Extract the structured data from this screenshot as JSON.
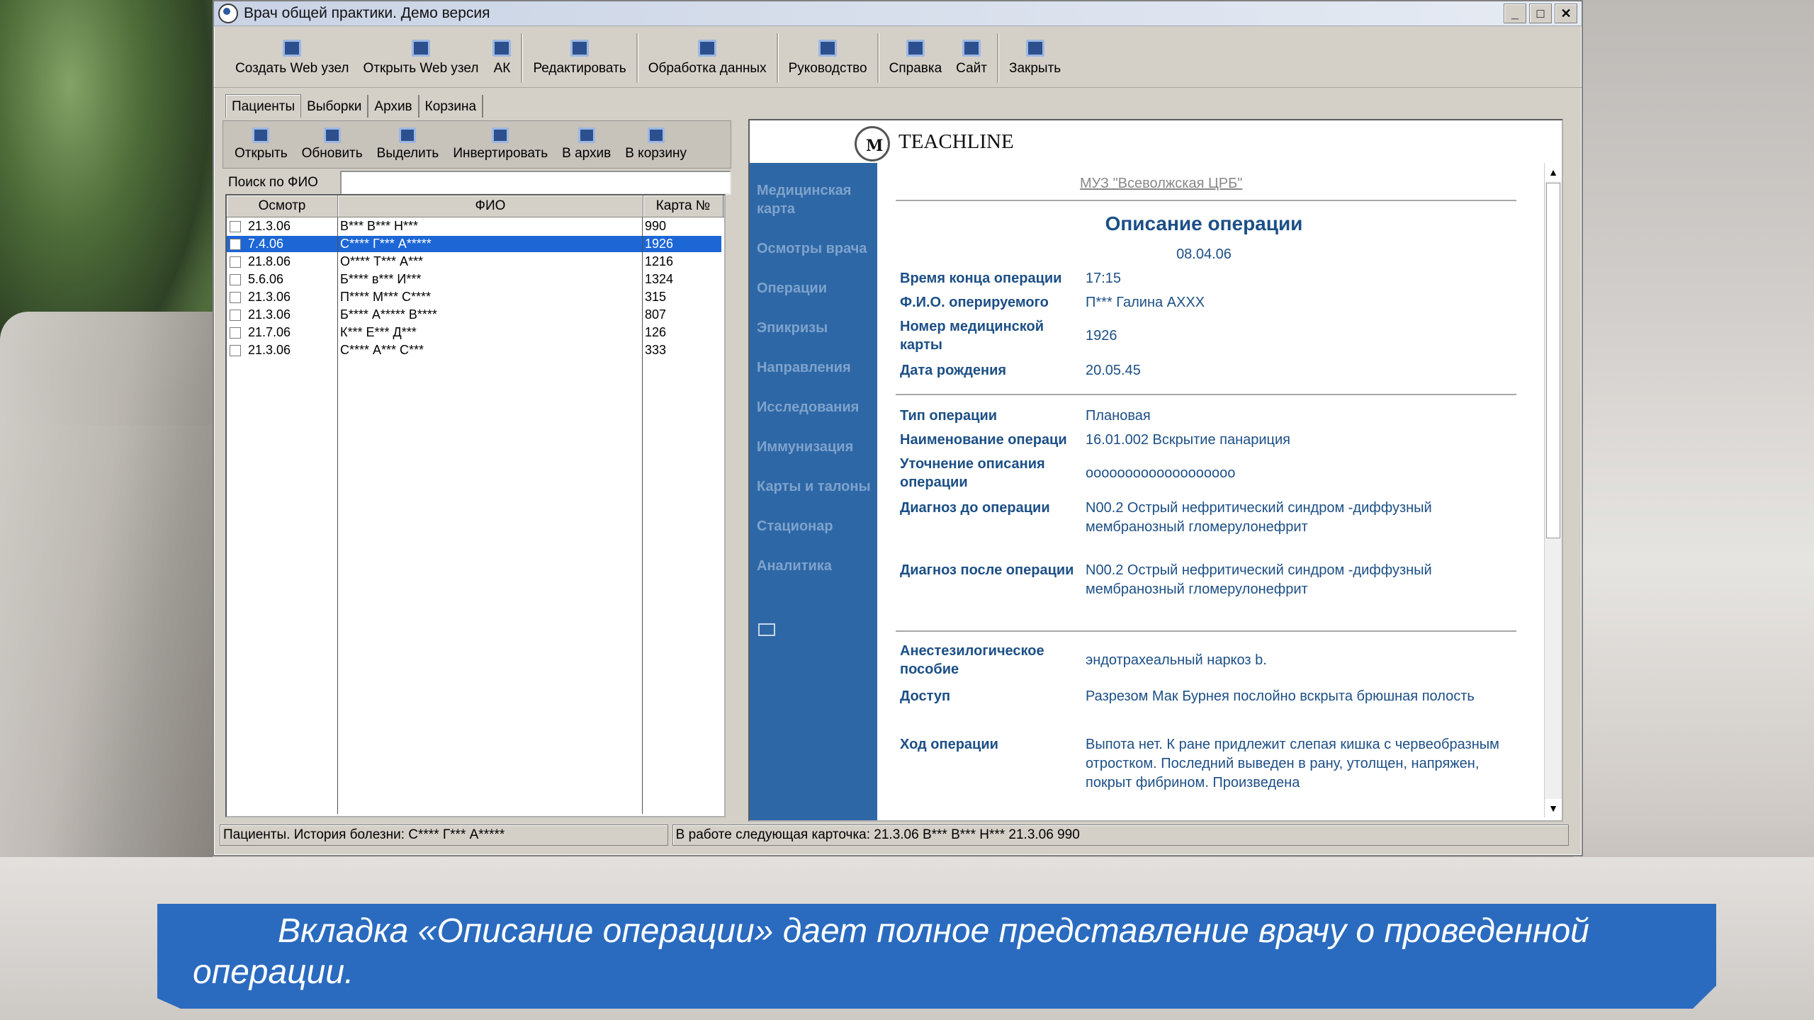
{
  "window": {
    "title": "Врач общей практики. Демо версия",
    "controls": [
      "_",
      "□",
      "✕"
    ]
  },
  "toolbar": [
    {
      "label": "Создать Web узел",
      "icon": "web-create-icon"
    },
    {
      "label": "Открыть Web узел",
      "icon": "web-open-icon"
    },
    {
      "label": "АК",
      "icon": "ak-icon"
    },
    {
      "label": "Редактировать",
      "icon": "edit-icon"
    },
    {
      "label": "Обработка данных",
      "icon": "data-processing-icon"
    },
    {
      "label": "Руководство",
      "icon": "manual-icon"
    },
    {
      "label": "Справка",
      "icon": "help-icon"
    },
    {
      "label": "Сайт",
      "icon": "site-icon"
    },
    {
      "label": "Закрыть",
      "icon": "close-x-icon"
    }
  ],
  "left_panel": {
    "tabs": [
      "Пациенты",
      "Выборки",
      "Архив",
      "Корзина"
    ],
    "actions": [
      {
        "label": "Открыть",
        "icon": "open-icon"
      },
      {
        "label": "Обновить",
        "icon": "refresh-icon"
      },
      {
        "label": "Выделить",
        "icon": "select-icon"
      },
      {
        "label": "Инвертировать",
        "icon": "invert-icon"
      },
      {
        "label": "В архив",
        "icon": "archive-icon"
      },
      {
        "label": "В корзину",
        "icon": "trash-icon"
      }
    ],
    "search_label": "Поиск по ФИО",
    "search_value": "",
    "columns": [
      "Осмотр",
      "ФИО",
      "Карта №"
    ],
    "rows": [
      {
        "date": "21.3.06",
        "name": "В*** В*** Н***",
        "card": "990"
      },
      {
        "date": "7.4.06",
        "name": "С**** Г*** А*****",
        "card": "1926"
      },
      {
        "date": "21.8.06",
        "name": "О**** Т*** А***",
        "card": "1216"
      },
      {
        "date": "5.6.06",
        "name": "Б**** в*** И***",
        "card": "1324"
      },
      {
        "date": "21.3.06",
        "name": "П**** М*** С****",
        "card": "315"
      },
      {
        "date": "21.3.06",
        "name": "Б**** А***** В****",
        "card": "807"
      },
      {
        "date": "21.7.06",
        "name": "К*** Е*** Д***",
        "card": "126"
      },
      {
        "date": "21.3.06",
        "name": "С**** А*** С***",
        "card": "333"
      }
    ]
  },
  "right_panel": {
    "brand": "TEACHLINE",
    "sidebar": [
      "Медицинская карта",
      "Осмотры врача",
      "Операции",
      "Эпикризы",
      "Направления",
      "Исследования",
      "Иммунизация",
      "Карты и талоны",
      "Стационар",
      "Аналитика"
    ],
    "org": "МУЗ \"Всеволжская ЦРБ\"",
    "title": "Описание операции",
    "date": "08.04.06",
    "fields": [
      {
        "label": "Время конца операции",
        "value": "17:15"
      },
      {
        "label": "Ф.И.О. оперируемого",
        "value": "П*** Галина АХХХ"
      },
      {
        "label": "Номер медицинской карты",
        "value": "1926"
      },
      {
        "label": "Дата рождения",
        "value": "20.05.45"
      },
      {
        "label": "Тип операции",
        "value": "Плановая"
      },
      {
        "label": "Наименование операци",
        "value": "16.01.002 Вскрытие панариция"
      },
      {
        "label": "Уточнение описания операции",
        "value": "ооооооооооооооооооо"
      },
      {
        "label": "Диагноз до операции",
        "value": "N00.2 Острый нефритический синдром -диффузный мембранозный гломерулонефрит"
      },
      {
        "label": "Диагноз после операции",
        "value": "N00.2 Острый нефритический синдром -диффузный мембранозный гломерулонефрит"
      },
      {
        "label": "Анестезилогическое пособие",
        "value": "эндотрахеальный наркоз b."
      },
      {
        "label": "Доступ",
        "value": "Разрезом Мак Бурнея послойно вскрыта брюшная полость"
      },
      {
        "label": "Ход операции",
        "value": "Выпота нет. К ране придлежит слепая кишка с червеобразным отростком. Последний выведен в рану, утолщен, напряжен, покрыт фибрином. Произведена"
      }
    ]
  },
  "status": {
    "left": "Пациенты. История болезни: С**** Г*** А*****",
    "right": "В работе следующая карточка:  21.3.06 В*** В*** Н***  21.3.06 990"
  },
  "caption": "Вкладка «Описание операции» дает полное представление  врачу о проведенной операции.",
  "colors": {
    "sidebar": "#2e67a6",
    "caption": "#2a6bbf",
    "selection": "#1c66d6",
    "doc_text": "#1c4f86"
  }
}
